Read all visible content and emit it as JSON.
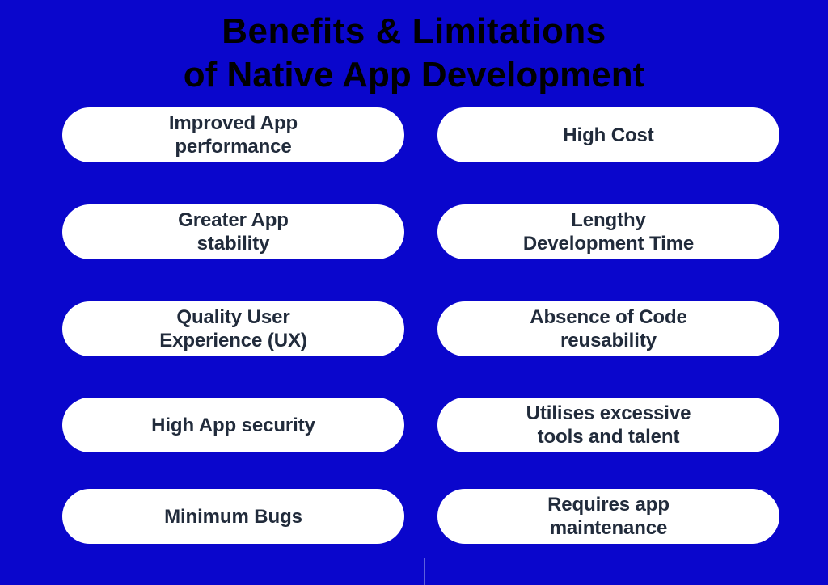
{
  "background_color": "#0a06cc",
  "title": {
    "line_1": "Benefits  &  Limitations",
    "line_2": "of Native App Development",
    "color": "#000000"
  },
  "pill_style": {
    "fill_color": "#ffffff",
    "text_color": "#212b3b"
  },
  "columns": {
    "benefits": {
      "items": [
        {
          "label": "Improved App\nperformance"
        },
        {
          "label": "Greater App\nstability"
        },
        {
          "label": "Quality User\nExperience (UX)"
        },
        {
          "label": "High App security"
        },
        {
          "label": "Minimum Bugs"
        }
      ]
    },
    "limitations": {
      "items": [
        {
          "label": "High Cost"
        },
        {
          "label": "Lengthy\nDevelopment Time"
        },
        {
          "label": "Absence of Code\nreusability"
        },
        {
          "label": "Utilises excessive\ntools and talent"
        },
        {
          "label": "Requires app\nmaintenance"
        }
      ]
    }
  },
  "divider": {
    "color": "#a0aaeb"
  }
}
